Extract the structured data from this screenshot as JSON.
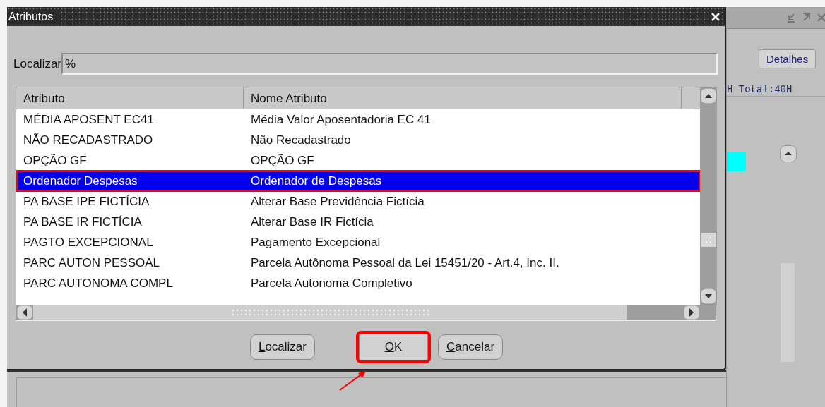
{
  "background_window": {
    "details_button": "Detalhes",
    "summary_text": "H Total:40H"
  },
  "dialog": {
    "title": "Atributos",
    "search": {
      "label": "Localizar",
      "value": "%"
    },
    "table": {
      "columns": [
        "Atributo",
        "Nome Atributo"
      ],
      "rows": [
        {
          "cells": [
            "MÉDIA APOSENT EC41",
            "Média Valor Aposentadoria EC 41"
          ],
          "selected": false,
          "highlighted": false
        },
        {
          "cells": [
            "NÃO RECADASTRADO",
            "Não Recadastrado"
          ],
          "selected": false,
          "highlighted": false
        },
        {
          "cells": [
            "OPÇÃO GF",
            "OPÇÃO GF"
          ],
          "selected": false,
          "highlighted": false
        },
        {
          "cells": [
            "Ordenador Despesas",
            "Ordenador de Despesas"
          ],
          "selected": true,
          "highlighted": true
        },
        {
          "cells": [
            "PA BASE IPE FICTÍCIA",
            "Alterar Base Previdência Fictícia"
          ],
          "selected": false,
          "highlighted": false
        },
        {
          "cells": [
            "PA BASE IR FICTÍCIA",
            "Alterar Base IR Fictícia"
          ],
          "selected": false,
          "highlighted": false
        },
        {
          "cells": [
            "PAGTO EXCEPCIONAL",
            "Pagamento Excepcional"
          ],
          "selected": false,
          "highlighted": false
        },
        {
          "cells": [
            "PARC AUTON PESSOAL",
            "Parcela Autônoma Pessoal da Lei 15451/20 - Art.4, Inc. II."
          ],
          "selected": false,
          "highlighted": false
        },
        {
          "cells": [
            "PARC AUTONOMA COMPL",
            "Parcela Autonoma Completivo"
          ],
          "selected": false,
          "highlighted": false
        }
      ]
    },
    "buttons": [
      {
        "label": "Localizar",
        "highlighted": false
      },
      {
        "label": "OK",
        "highlighted": true
      },
      {
        "label": "Cancelar",
        "highlighted": false
      }
    ]
  }
}
